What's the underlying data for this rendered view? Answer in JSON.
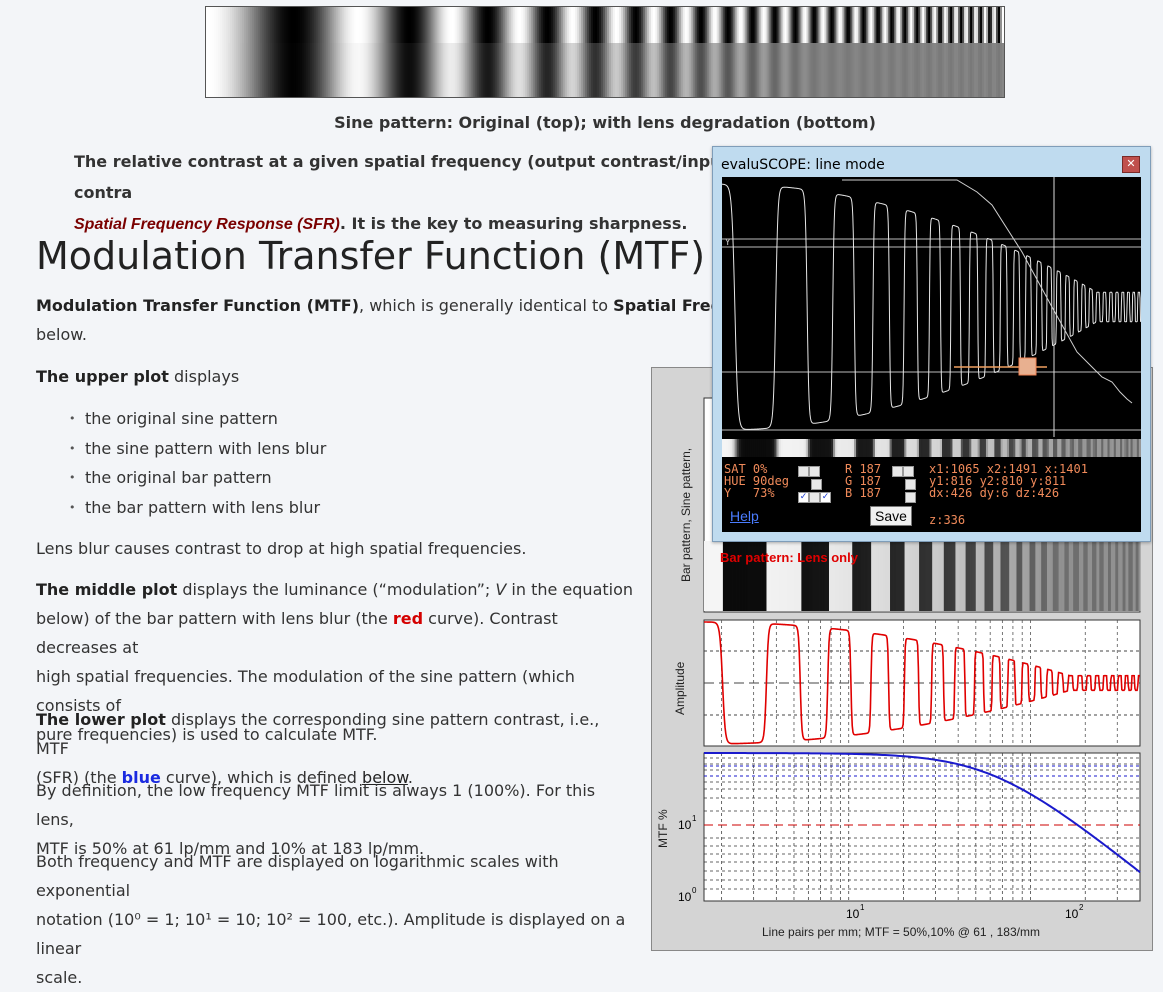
{
  "caption": "Sine pattern: Original (top); with lens degradation (bottom)",
  "intro": {
    "line1": "The relative contrast at a given spatial frequency (output contrast/input contra",
    "sfr_term": "Spatial Frequency Response (SFR)",
    "line2_rest": ". It is the key to measuring sharpness."
  },
  "heading": "Modulation Transfer Function (MTF)",
  "mtf_para": {
    "term1": "Modulation Transfer Function (MTF)",
    "middle": ", which is generally identical to ",
    "term2": "Spatial Frequency",
    "line2": "below."
  },
  "upper": {
    "lead": "The upper plot",
    "rest": " displays"
  },
  "bullets": [
    "the original sine pattern",
    "the sine pattern with lens blur",
    "the original bar pattern",
    "the bar pattern with lens blur"
  ],
  "lens_blur": "Lens blur causes contrast to drop at high spatial frequencies.",
  "middle": {
    "lead": "The middle plot",
    "p1": " displays the luminance (“modulation”; ",
    "v": "V",
    "p2": " in the equation",
    "line2a": "below) of the bar pattern with lens blur (the ",
    "red": "red",
    "line2b": " curve). Contrast decreases at",
    "line3": "high spatial frequencies. The modulation of the sine pattern (which consists of",
    "line4": "pure frequencies) is used to calculate MTF."
  },
  "lower": {
    "lead": "The lower plot",
    "p1": " displays the corresponding sine pattern contrast, i.e., MTF",
    "line2a": "(SFR) (the ",
    "blue": "blue",
    "line2b": " curve), which is defined ",
    "below_link": "below",
    "line2c": "."
  },
  "definition": {
    "line1": "By definition, the low frequency MTF limit is always 1 (100%). For this lens,",
    "line2": "MTF is 50% at 61 lp/mm and 10% at 183 lp/mm."
  },
  "scales": {
    "line1": "Both frequency and MTF are displayed on logarithmic scales with exponential",
    "line2": "notation (10⁰ = 1; 10¹ = 10; 10² = 100, etc.). Amplitude is displayed on a linear",
    "line3": "scale."
  },
  "figure": {
    "ylabel_top": "Bar pattern, Sine pattern,",
    "bar_label": "Bar pattern: Lens only",
    "ylabel_mid": "Amplitude",
    "ylabel_low": "MTF %",
    "ytick_hi": "10",
    "ytick_hi_exp": "1",
    "ytick_lo": "10",
    "ytick_lo_exp": "0",
    "xtick1": "10",
    "xtick1_exp": "1",
    "xtick2": "10",
    "xtick2_exp": "2",
    "xlabel": "Line pairs per mm;  MTF = 50%,10% @ 61 , 183/mm",
    "colors": {
      "bar_curve": "#e00000",
      "mtf_curve": "#1a1acc",
      "ten_pct_line": "#cc0000"
    }
  },
  "scope": {
    "title": "evaluSCOPE: line mode",
    "close_icon": "close-icon",
    "y_marker": "Y",
    "sat": "SAT 0%",
    "hue": "HUE 90deg",
    "y": "Y   73%",
    "r": "R 187",
    "g": "G 187",
    "b": "B 187",
    "coords1": "x1:1065 x2:1491 x:1401",
    "coords2": "y1:816 y2:810 y:811",
    "coords3": "dx:426 dy:6 dz:426",
    "z": "z:336",
    "help": "Help",
    "save": "Save"
  }
}
